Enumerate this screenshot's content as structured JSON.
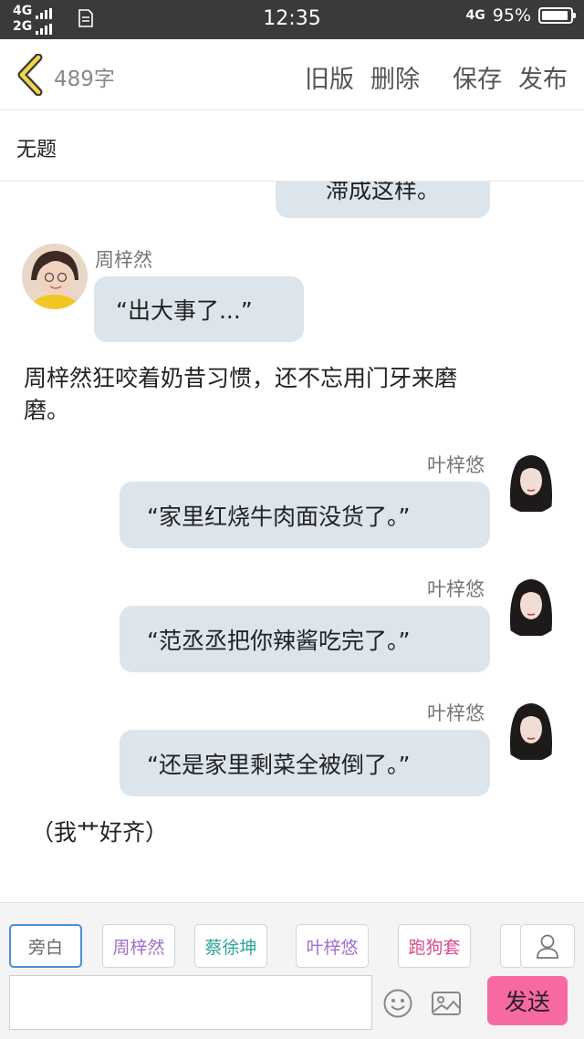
{
  "status_bar": {
    "network_top": "4G",
    "network_bottom": "2G",
    "time": "12:35",
    "network_right": "4G",
    "battery": "95%",
    "battery_level": 0.95
  },
  "top_nav": {
    "word_count": "489字",
    "actions": [
      "旧版",
      "删除",
      "保存",
      "发布"
    ]
  },
  "title": "无题",
  "messages": [
    {
      "type": "bubble_partial",
      "text": "滞成这样。"
    },
    {
      "type": "left",
      "speaker": "周梓然",
      "avatar": "avatar-girl-yellow",
      "text": "“出大事了...”"
    },
    {
      "type": "narration",
      "lines": [
        "周梓然狂咬着奶昔习惯，还不忘用门牙来磨",
        "磨。"
      ]
    },
    {
      "type": "right",
      "speaker": "叶梓悠",
      "avatar": "avatar-girl-longhair",
      "text": "“家里红烧牛肉面没货了。”"
    },
    {
      "type": "right",
      "speaker": "叶梓悠",
      "avatar": "avatar-girl-longhair",
      "text": "“范丞丞把你辣酱吃完了。”"
    },
    {
      "type": "right",
      "speaker": "叶梓悠",
      "avatar": "avatar-girl-longhair",
      "text": "“还是家里剩菜全被倒了。”"
    },
    {
      "type": "narration",
      "lines": [
        "（我艹好齐）"
      ]
    }
  ],
  "bottom_bar": {
    "roles": [
      {
        "label": "旁白",
        "color": "#666666",
        "active": true
      },
      {
        "label": "周梓然",
        "color": "#a06fc9",
        "active": false
      },
      {
        "label": "蔡徐坤",
        "color": "#2ba39a",
        "active": false
      },
      {
        "label": "叶梓悠",
        "color": "#a06fc9",
        "active": false
      },
      {
        "label": "跑狗套",
        "color": "#d94a8c",
        "active": false
      }
    ],
    "input_value": "",
    "send_label": "发送",
    "icons": [
      "person-icon",
      "emoji-icon",
      "image-icon"
    ]
  }
}
